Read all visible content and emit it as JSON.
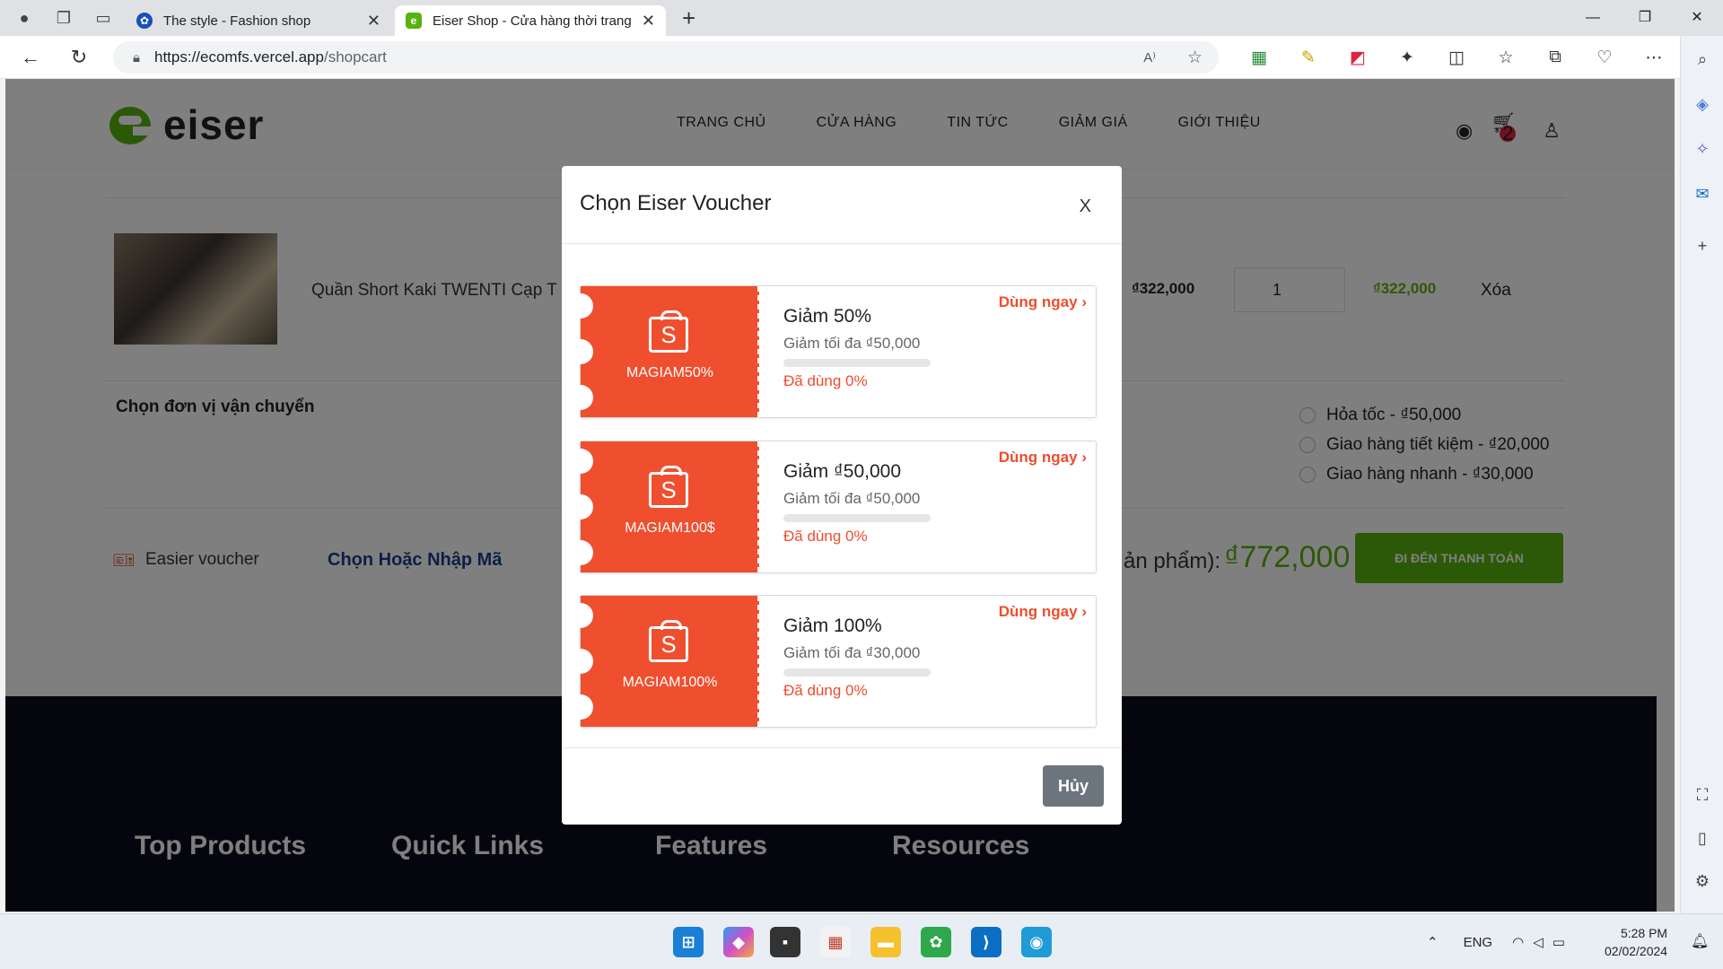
{
  "browser": {
    "tabs": [
      {
        "title": "The style - Fashion shop",
        "active": false
      },
      {
        "title": "Eiser Shop - Cửa hàng thời trang",
        "active": true
      }
    ],
    "url_host": "https://ecomfs.vercel.app",
    "url_path": "/shopcart"
  },
  "site": {
    "logo_text": "eiser",
    "menu": [
      "TRANG CHỦ",
      "CỬA HÀNG",
      "TIN TỨC",
      "GIẢM GIÁ",
      "GIỚI THIỆU"
    ],
    "cart_count": "2"
  },
  "cart": {
    "product_name": "Quần Short Kaki TWENTI Cạp T",
    "price": "₫322,000",
    "quantity": "1",
    "total": "₫322,000",
    "delete_label": "Xóa",
    "shipping_label": "Chọn đơn vị vận chuyển",
    "shipping_options": [
      "Hỏa tốc - ₫50,000",
      "Giao hàng tiết kiệm - ₫20,000",
      "Giao hàng nhanh - ₫30,000"
    ],
    "voucher_label": "Easier voucher",
    "voucher_link": "Chọn Hoặc Nhập Mã",
    "total_label": "ản phẩm):",
    "total_amount": "₫772,000",
    "checkout_label": "ĐI ĐẾN THANH TOÁN"
  },
  "footer": {
    "cols": [
      "Top Products",
      "Quick Links",
      "Features",
      "Resources"
    ]
  },
  "modal": {
    "title": "Chọn Eiser Voucher",
    "close_label": "X",
    "cancel_label": "Hủy",
    "vouchers": [
      {
        "code": "MAGIAM50%",
        "title": "Giảm 50%",
        "max": "Giảm tối đa ₫50,000",
        "used": "Đã dùng 0%",
        "used_fraction": 0,
        "action": "Dùng ngay"
      },
      {
        "code": "MAGIAM100$",
        "title": "Giảm ₫50,000",
        "max": "Giảm tối đa ₫50,000",
        "used": "Đã dùng 0%",
        "used_fraction": 0,
        "action": "Dùng ngay"
      },
      {
        "code": "MAGIAM100%",
        "title": "Giảm 100%",
        "max": "Giảm tối đa ₫30,000",
        "used": "Đã dùng 0%",
        "used_fraction": 0,
        "action": "Dùng ngay"
      }
    ]
  },
  "taskbar": {
    "lang": "ENG",
    "time": "5:28 PM",
    "date": "02/02/2024"
  },
  "colors": {
    "brand_green": "#59b210",
    "voucher_orange": "#ef4f2f"
  }
}
